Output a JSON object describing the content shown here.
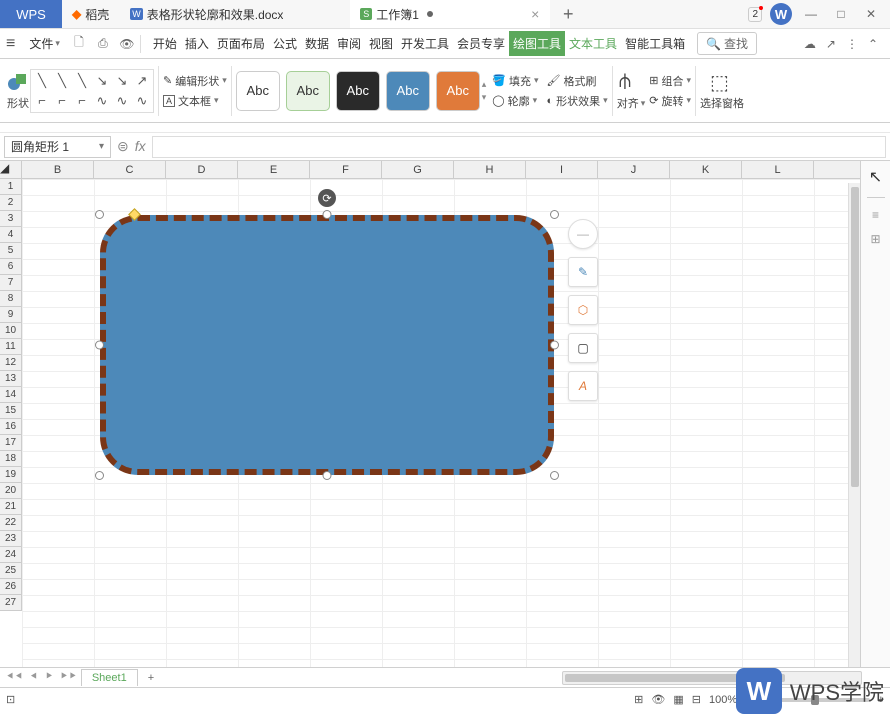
{
  "titlebar": {
    "app_tab": "WPS",
    "tabs": [
      {
        "icon": "docer-icon",
        "label": "稻壳",
        "color": "#ff6a00"
      },
      {
        "icon": "word-icon",
        "label": "表格形状轮廓和效果.docx",
        "color": "#4472c4"
      },
      {
        "icon": "sheet-icon",
        "label": "工作簿1",
        "color": "#5ba85b",
        "active": true
      }
    ],
    "badge_number": "2"
  },
  "menubar": {
    "file_label": "文件",
    "tabs": [
      "开始",
      "插入",
      "页面布局",
      "公式",
      "数据",
      "审阅",
      "视图",
      "开发工具",
      "会员专享",
      "绘图工具",
      "文本工具",
      "智能工具箱"
    ],
    "active_green_index": 9,
    "green_text_index": 10,
    "search_label": "查找"
  },
  "ribbon": {
    "shape_label": "形状",
    "edit_shape": "编辑形状",
    "text_box": "文本框",
    "style_swatches": [
      {
        "text": "Abc",
        "bg": "#ffffff",
        "fg": "#333",
        "border": "#ccc"
      },
      {
        "text": "Abc",
        "bg": "#eaf4e6",
        "fg": "#333",
        "border": "#a6cf97"
      },
      {
        "text": "Abc",
        "bg": "#2a2a2a",
        "fg": "#fff",
        "border": "#2a2a2a"
      },
      {
        "text": "Abc",
        "bg": "#4d89b9",
        "fg": "#fff",
        "border": "#396c96"
      },
      {
        "text": "Abc",
        "bg": "#e07a3a",
        "fg": "#fff",
        "border": "#c46428"
      }
    ],
    "fill_label": "填充",
    "outline_label": "轮廓",
    "format_painter": "格式刷",
    "shape_effect": "形状效果",
    "align_label": "对齐",
    "group_label": "组合",
    "rotate_label": "旋转",
    "selection_pane": "选择窗格"
  },
  "formula": {
    "name_box": "圆角矩形 1",
    "fx_label": "fx"
  },
  "sheet": {
    "columns": [
      "B",
      "C",
      "D",
      "E",
      "F",
      "G",
      "H",
      "I",
      "J",
      "K",
      "L"
    ],
    "rows": [
      "1",
      "2",
      "3",
      "4",
      "5",
      "6",
      "7",
      "8",
      "9",
      "10",
      "11",
      "12",
      "13",
      "14",
      "15",
      "16",
      "17",
      "18",
      "19",
      "20",
      "21",
      "22",
      "23",
      "24",
      "25",
      "26",
      "27"
    ]
  },
  "shape": {
    "fill_color": "#4d89b9",
    "border_color": "#7a3617",
    "border_style": "dashed"
  },
  "sheettabs": {
    "active": "Sheet1"
  },
  "statusbar": {
    "zoom": "100%"
  },
  "watermark": {
    "text": "WPS学院",
    "logo": "W"
  }
}
